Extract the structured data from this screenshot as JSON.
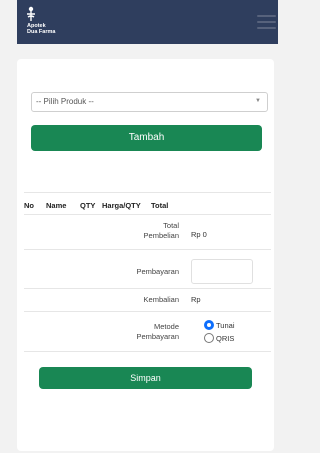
{
  "navbar": {
    "logo_text": [
      "Apotek",
      "Dua Farma"
    ]
  },
  "form": {
    "product_select": "-- Pilih Produk --",
    "add_button": "Tambah"
  },
  "table": {
    "columns": [
      "No",
      "Name",
      "QTY",
      "Harga/QTY",
      "Total"
    ]
  },
  "summary": {
    "total_label": [
      "Total",
      "Pembelian"
    ],
    "total_value": "Rp 0",
    "payment_label": "Pembayaran",
    "payment_value": "",
    "change_label": "Kembalian",
    "change_value": "Rp",
    "method_label": [
      "Metode",
      "Pembayaran"
    ],
    "methods": [
      {
        "label": "Tunai",
        "checked": true
      },
      {
        "label": "QRIS",
        "checked": false
      }
    ]
  },
  "save_button": "Simpan",
  "colors": {
    "navbar": "#2f3e5e",
    "primary_green": "#198754",
    "radio_selected": "#0d6efd"
  }
}
